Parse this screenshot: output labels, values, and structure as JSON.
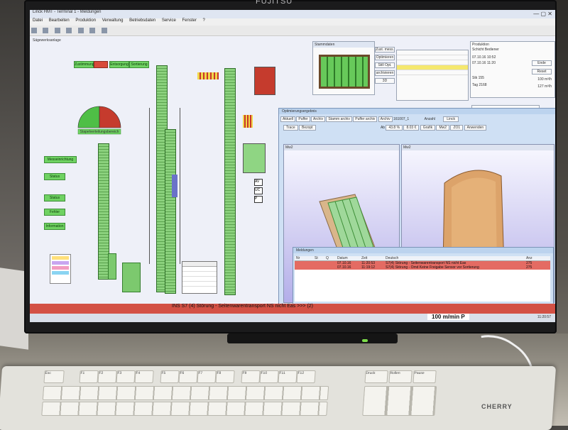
{
  "monitor": {
    "brand": "FUJITSU"
  },
  "app": {
    "window_title": "Linck HMT - Terminal 1 - Meldungen",
    "menu": [
      "Datei",
      "Bearbeiten",
      "Produktion",
      "Verwaltung",
      "Betriebsdaten",
      "Service",
      "Fenster",
      "?"
    ],
    "plant_window_title": "Sägewerksanlage",
    "buttons_top": [
      {
        "label": "Zustimmung",
        "color": "#6fd262"
      },
      {
        "label": "",
        "color": "#d84a3a"
      },
      {
        "label": "Entsorgung",
        "color": "#6fd262"
      },
      {
        "label": "Sortierung",
        "color": "#6fd262"
      }
    ],
    "gauge_label": "Stapelverteilungsbereich",
    "left_buttons": [
      "Messeinrichtung",
      "Status",
      "Status",
      "Fehler",
      "Information"
    ],
    "stack_window_title": "Stammdaten",
    "side_buttons": [
      "Zust. mess.",
      "Optimieren",
      "Still Opt.",
      "archivieren",
      "3D"
    ],
    "production_title": "Produktion",
    "production_fields": {
      "schicht_label": "Schicht",
      "bediener_label": "Bediener",
      "date1": "07.10.16 10:52",
      "date2": "07.10.16 11:20",
      "ende": "Ende",
      "reset": "Reset",
      "stk_label": "Stk",
      "stk_value": "155",
      "tag_label": "Tag",
      "tag_value": "2168",
      "m3_value": "100 m³/h",
      "rate_value": "127 m³/h"
    },
    "opt_window_title": "Optimierungsergebnis",
    "opt_tabs": [
      "Aktuell",
      "Puffer",
      "Archiv",
      "Stamm archiv",
      "Puffer archiv",
      "Archiv"
    ],
    "opt_archive_id": "161007_1",
    "opt_anzahl_label": "Anzahl",
    "opt_linck": "Linck",
    "opt_fields": {
      "ab_label": "Ab",
      "ab_value": "43.8 %",
      "val2": "8.03 €",
      "grafik": "Grafik",
      "mw": "Mw2",
      "zoom": "ZO1",
      "trace": "Trace",
      "bezopt": "Bezopt",
      "anwenden": "Anwenden"
    },
    "viewport_left_title": "Mw2",
    "viewport_right_title": "Mw2",
    "messages_window_title": "Meldungen",
    "messages_headers": [
      "Nr",
      "St",
      "Q",
      "Datum",
      "Zeit",
      "Deutsch",
      "Anz"
    ],
    "messages_rows": [
      {
        "nr": "",
        "datum": "07.10.16",
        "zeit": "11:20:53",
        "text": "S7(4) Störung - Seitenwarentransport NS nicht Eas",
        "anz": "275"
      },
      {
        "nr": "",
        "datum": "07.10.16",
        "zeit": "11:19:12",
        "text": "S7(4) Störung - Omd Keine Freigabe Sensor vor Sortierung",
        "anz": "275"
      }
    ],
    "status_bar_text": "INS S7 (4) Störung - Seitenwarentransport NS nicht Eas >>> (2)",
    "speed_display": "100 m/min P",
    "status_clock": "11:20:57"
  },
  "keyboard": {
    "brand": "CHERRY",
    "keys_row1": [
      "Esc",
      "F1",
      "F2",
      "F3",
      "F4",
      "F5",
      "F6",
      "F7",
      "F8",
      "F9",
      "F10",
      "F11",
      "F12",
      "Druck",
      "Rollen",
      "Pause"
    ]
  },
  "colors": {
    "accent_green": "#6fd262",
    "alarm_red": "#d35145",
    "screen_bg": "#f3f4fb"
  }
}
